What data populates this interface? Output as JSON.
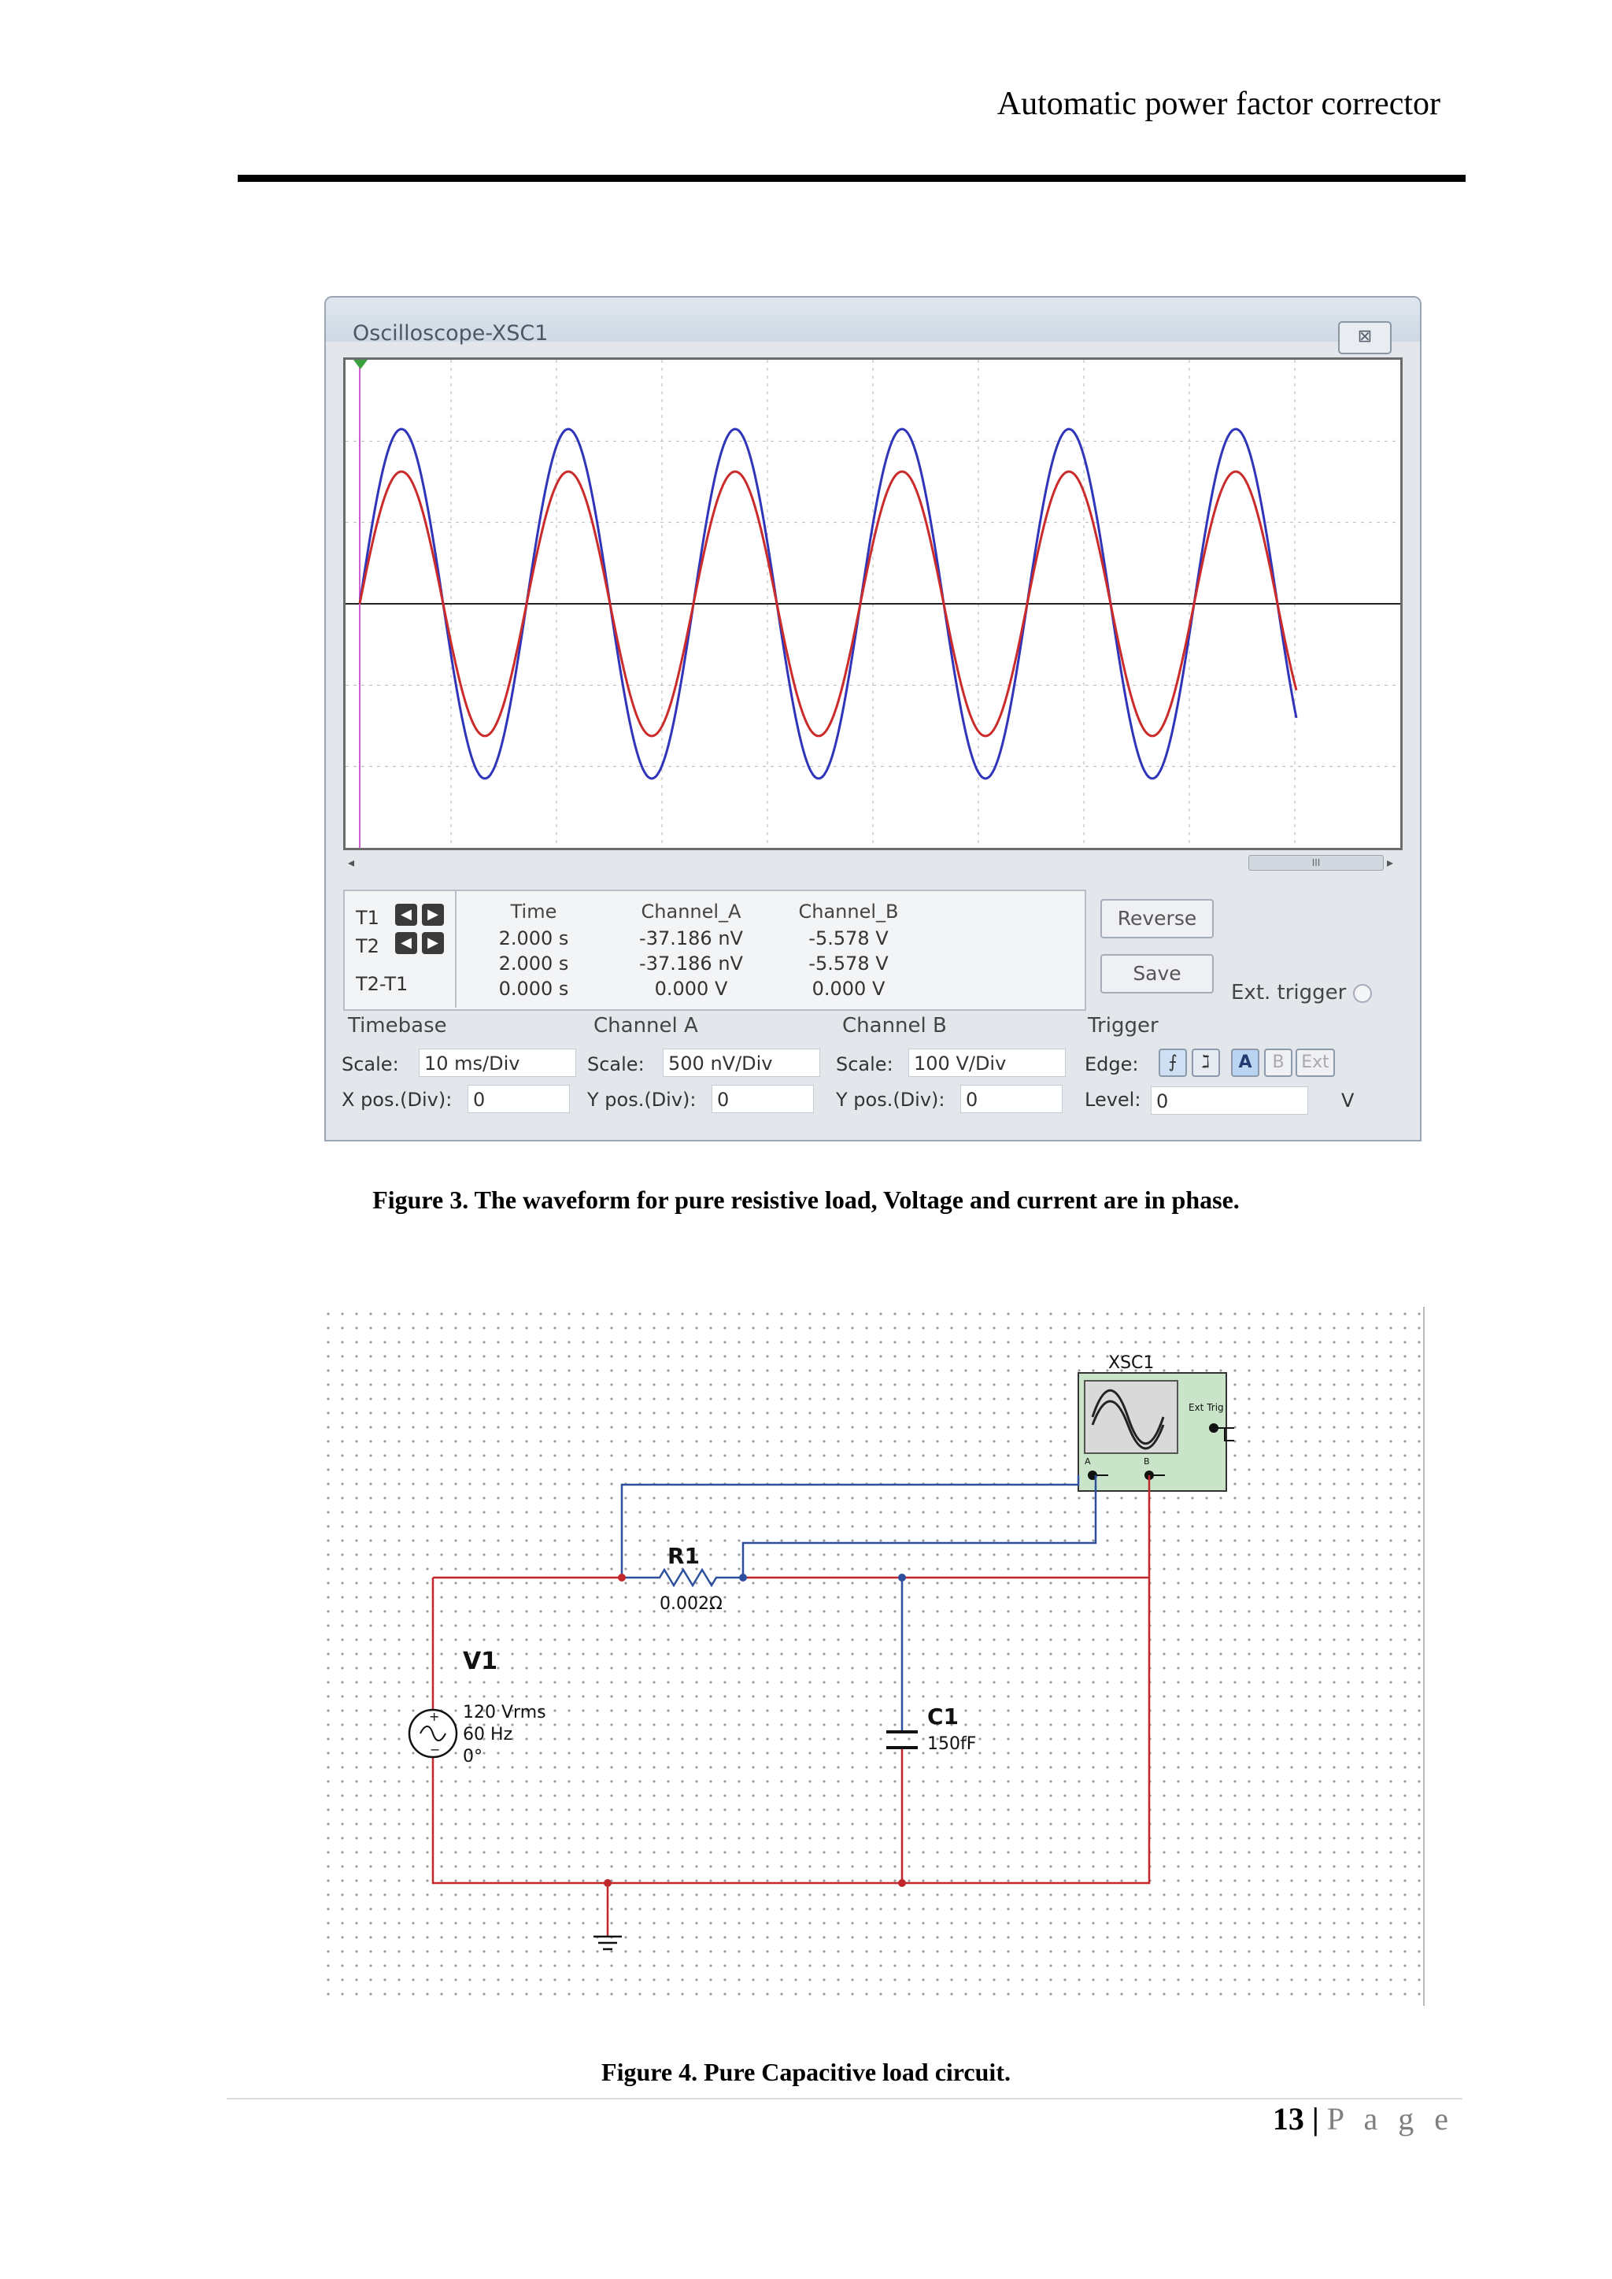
{
  "header": {
    "title": "Automatic power factor corrector"
  },
  "oscilloscope": {
    "window_title": "Oscilloscope-XSC1",
    "close_glyph": "⊠",
    "scroll_thumb": "III",
    "readout": {
      "row_labels": [
        "T1",
        "T2",
        "T2-T1"
      ],
      "headers": [
        "Time",
        "Channel_A",
        "Channel_B"
      ],
      "rows": [
        [
          "2.000 s",
          "-37.186 nV",
          "-5.578 V"
        ],
        [
          "2.000 s",
          "-37.186 nV",
          "-5.578 V"
        ],
        [
          "0.000 s",
          "0.000 V",
          "0.000 V"
        ]
      ]
    },
    "buttons": {
      "reverse": "Reverse",
      "save": "Save"
    },
    "ext_trigger": "Ext. trigger",
    "timebase": {
      "title": "Timebase",
      "scale_label": "Scale:",
      "scale": "10 ms/Div",
      "pos_label": "X pos.(Div):",
      "pos": "0"
    },
    "channel_a": {
      "title": "Channel A",
      "scale_label": "Scale:",
      "scale": "500 nV/Div",
      "pos_label": "Y pos.(Div):",
      "pos": "0"
    },
    "channel_b": {
      "title": "Channel B",
      "scale_label": "Scale:",
      "scale": "100  V/Div",
      "pos_label": "Y pos.(Div):",
      "pos": "0"
    },
    "trigger": {
      "title": "Trigger",
      "edge_label": "Edge:",
      "level_label": "Level:",
      "level": "0",
      "level_unit": "V",
      "src_a": "A",
      "src_b": "B",
      "src_ext": "Ext"
    },
    "colors": {
      "channel_a": "#cc2b2b",
      "channel_b": "#2f34b8"
    }
  },
  "figure3_caption": "Figure 3. The waveform for pure resistive load, Voltage and current are in phase.",
  "schematic": {
    "scope_label": "XSC1",
    "scope_ext_trig": "Ext Trig",
    "scope_a": "A",
    "scope_b": "B",
    "r1_name": "R1",
    "r1_value": "0.002Ω",
    "v1_name": "V1",
    "v1_voltage": "120 Vrms",
    "v1_freq": "60 Hz",
    "v1_phase": "0°",
    "c1_name": "C1",
    "c1_value": "150fF",
    "wire_colors": {
      "power": "#c0282c",
      "probe": "#2d4f9e"
    }
  },
  "figure4_caption": "Figure 4. Pure Capacitive load circuit.",
  "footer": {
    "page_number": "13",
    "separator": "|",
    "page_word": "P a g e"
  }
}
